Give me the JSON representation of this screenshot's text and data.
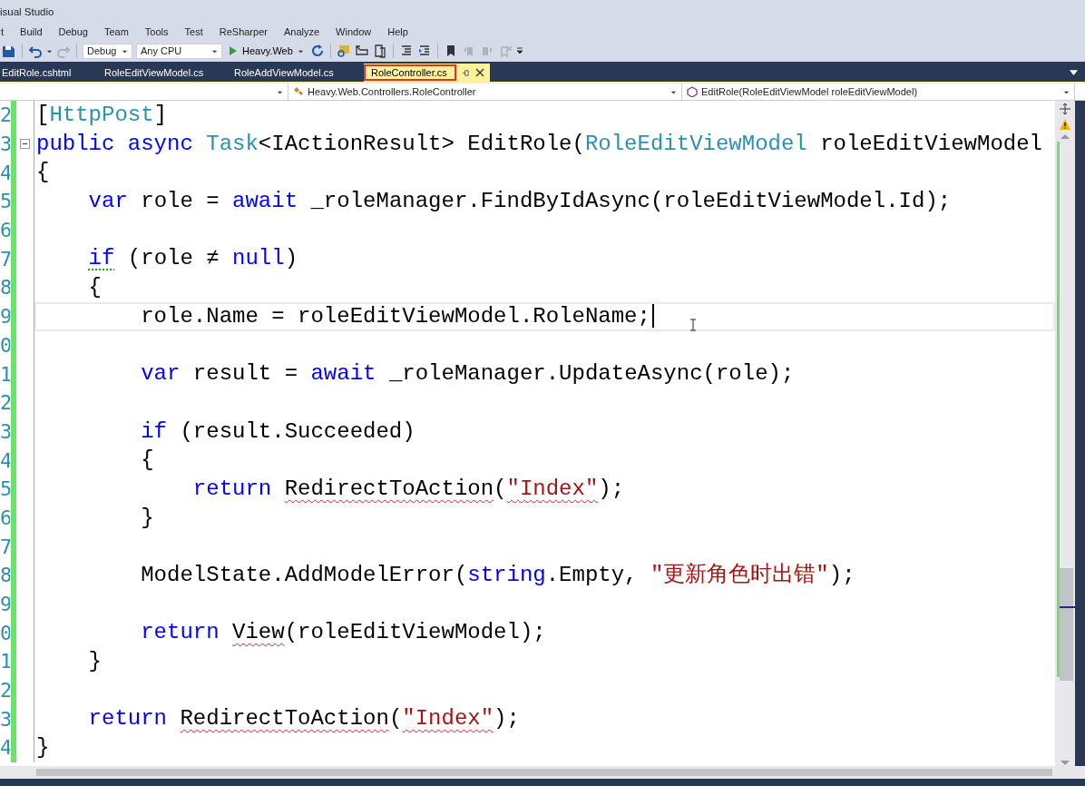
{
  "window": {
    "title": "isual Studio"
  },
  "menu": [
    "t",
    "Build",
    "Debug",
    "Team",
    "Tools",
    "Test",
    "ReSharper",
    "Analyze",
    "Window",
    "Help"
  ],
  "toolbar": {
    "configuration": "Debug",
    "platform": "Any CPU",
    "start_target": "Heavy.Web"
  },
  "tabs": [
    {
      "label": "EditRole.cshtml",
      "selected": false
    },
    {
      "label": "RoleEditViewModel.cs",
      "selected": false
    },
    {
      "label": "RoleAddViewModel.cs",
      "selected": false
    },
    {
      "label": "RoleController.cs",
      "selected": true
    }
  ],
  "nav_bar": {
    "class": "Heavy.Web.Controllers.RoleController",
    "member": "EditRole(RoleEditViewModel roleEditViewModel)"
  },
  "code": [
    {
      "number": "2",
      "current": false,
      "tokens": [
        {
          "t": "[",
          "kind": "plain"
        },
        {
          "t": "HttpPost",
          "kind": "type"
        },
        {
          "t": "]",
          "kind": "plain"
        }
      ]
    },
    {
      "number": "3",
      "current": false,
      "collapsible": true,
      "tokens": [
        {
          "t": "public async ",
          "kind": "keyword"
        },
        {
          "t": "Task",
          "kind": "type"
        },
        {
          "t": "<IActionResult> EditRole(",
          "kind": "plain"
        },
        {
          "t": "RoleEditViewModel",
          "kind": "type"
        },
        {
          "t": " roleEditViewModel",
          "kind": "plain"
        }
      ]
    },
    {
      "number": "4",
      "current": false,
      "tokens": [
        {
          "t": "{",
          "kind": "plain"
        }
      ],
      "children": [
        {
          "number": "5",
          "current": false,
          "tokens": [
            {
              "t": "var",
              "kind": "keyword"
            },
            {
              "t": " role = ",
              "kind": "plain"
            },
            {
              "t": "await",
              "kind": "keyword"
            },
            {
              "t": " _roleManager.FindByIdAsync(roleEditViewModel.Id);",
              "kind": "plain"
            }
          ]
        },
        {
          "number": "6"
        },
        {
          "number": "7",
          "current": false,
          "tokens": [
            {
              "t": "if",
              "kind": "keyword",
              "warning": true
            },
            {
              "t": " (role ≠ ",
              "kind": "plain"
            },
            {
              "t": "null",
              "kind": "keyword"
            },
            {
              "t": ")",
              "kind": "plain"
            }
          ]
        },
        {
          "number": "8",
          "current": false,
          "tokens": [
            {
              "t": "{",
              "kind": "plain"
            }
          ],
          "children": [
            {
              "number": "9",
              "current": true,
              "caret": true,
              "tokens": [
                {
                  "t": "role.Name = roleEditViewModel.RoleName;",
                  "kind": "plain"
                }
              ]
            },
            {
              "number": "0"
            },
            {
              "number": "1",
              "current": false,
              "tokens": [
                {
                  "t": "var",
                  "kind": "keyword"
                },
                {
                  "t": " result = ",
                  "kind": "plain"
                },
                {
                  "t": "await",
                  "kind": "keyword"
                },
                {
                  "t": " _roleManager.UpdateAsync(role);",
                  "kind": "plain"
                }
              ]
            },
            {
              "number": "2"
            },
            {
              "number": "3",
              "current": false,
              "tokens": [
                {
                  "t": "if",
                  "kind": "keyword"
                },
                {
                  "t": " (result.Succeeded)",
                  "kind": "plain"
                }
              ]
            },
            {
              "number": "4",
              "current": false,
              "tokens": [
                {
                  "t": "{",
                  "kind": "plain"
                }
              ],
              "children": [
                {
                  "number": "5",
                  "current": false,
                  "tokens": [
                    {
                      "t": "return ",
                      "kind": "keyword"
                    },
                    {
                      "t": "RedirectToAction",
                      "kind": "plain",
                      "error": true
                    },
                    {
                      "t": "(",
                      "kind": "plain"
                    },
                    {
                      "t": "\"Index\"",
                      "kind": "string",
                      "error": true
                    },
                    {
                      "t": ");",
                      "kind": "plain"
                    }
                  ]
                }
              ]
            },
            {
              "number": "6",
              "current": false,
              "tokens": [
                {
                  "t": "}",
                  "kind": "plain"
                }
              ]
            },
            {
              "number": "7"
            },
            {
              "number": "8",
              "current": false,
              "tokens": [
                {
                  "t": "ModelState.AddModelError(",
                  "kind": "plain"
                },
                {
                  "t": "string",
                  "kind": "keyword"
                },
                {
                  "t": ".Empty, ",
                  "kind": "plain"
                },
                {
                  "t": "\"更新角色时出错\"",
                  "kind": "string"
                },
                {
                  "t": ");",
                  "kind": "plain"
                }
              ]
            },
            {
              "number": "9"
            },
            {
              "number": "0",
              "current": false,
              "tokens": [
                {
                  "t": "return ",
                  "kind": "keyword"
                },
                {
                  "t": "View",
                  "kind": "plain",
                  "error": true
                },
                {
                  "t": "(roleEditViewModel);",
                  "kind": "plain"
                }
              ]
            }
          ]
        },
        {
          "number": "1",
          "current": false,
          "tokens": [
            {
              "t": "}",
              "kind": "plain"
            }
          ]
        },
        {
          "number": "2"
        },
        {
          "number": "3",
          "current": false,
          "tokens": [
            {
              "t": "return ",
              "kind": "keyword"
            },
            {
              "t": "RedirectToAction",
              "kind": "plain",
              "error": true
            },
            {
              "t": "(",
              "kind": "plain"
            },
            {
              "t": "\"Index\"",
              "kind": "string",
              "error": true
            },
            {
              "t": ");",
              "kind": "plain"
            }
          ]
        }
      ]
    },
    {
      "number": "4",
      "current": false,
      "tokens": [
        {
          "t": "}",
          "kind": "plain"
        }
      ]
    }
  ]
}
